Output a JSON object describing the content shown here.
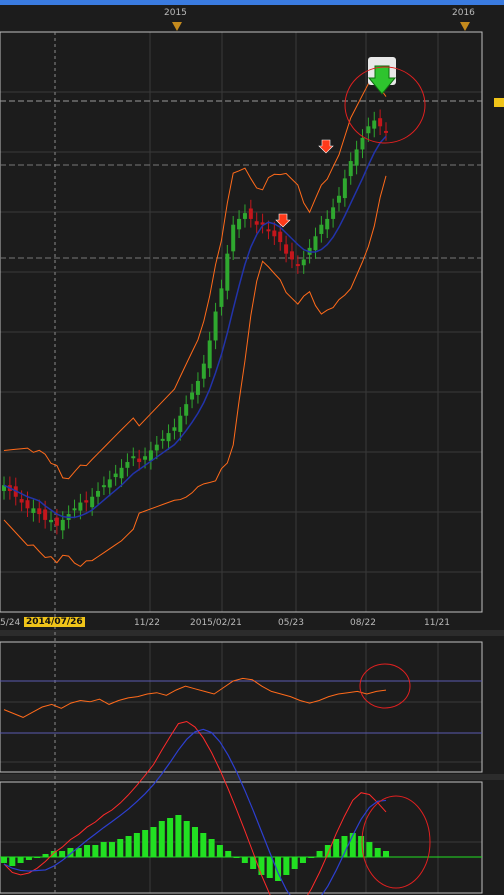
{
  "years": [
    "2015",
    "2016"
  ],
  "dates": [
    "5/24",
    "2014/07/26",
    "11/22",
    "2015/02/21",
    "05/23",
    "08/22",
    "11/21"
  ],
  "colors": {
    "background": "#1c1c1c",
    "grid": "#3a3a3a",
    "up_candle": "#2fa82f",
    "down_candle": "#c4161c",
    "bollinger": "#ff6a1a",
    "moving_avg": "#2233aa",
    "macd": "#ff2a2a",
    "signal": "#2d3fd0",
    "histogram": "#22e022",
    "marker_year": "#c48a1d",
    "annotation": "#e02020",
    "date_highlight": "#f0c419"
  },
  "chart_data": [
    {
      "type": "line",
      "panel": "price",
      "series": [
        {
          "name": "",
          "kind": "candles_close",
          "values": [
            100,
            99,
            98,
            97,
            96,
            96,
            95,
            94,
            94,
            93,
            94,
            95,
            96,
            97,
            97,
            98,
            99,
            100,
            101,
            102,
            103,
            104,
            105,
            104,
            105,
            106,
            107,
            108,
            109,
            110,
            112,
            114,
            116,
            118,
            121,
            125,
            130,
            134,
            140,
            145,
            146,
            147,
            146,
            145,
            145,
            144,
            143,
            142,
            140,
            139,
            138,
            139,
            141,
            143,
            145,
            146,
            148,
            150,
            153,
            156,
            158,
            160,
            162,
            163,
            162,
            161
          ]
        },
        {
          "name": "",
          "kind": "bollinger_upper"
        },
        {
          "name": "",
          "kind": "moving_average"
        },
        {
          "name": "",
          "kind": "bollinger_lower"
        }
      ],
      "signals": [
        "down-arrow",
        "down-arrow",
        "big-down-arrow"
      ],
      "grid": true
    },
    {
      "type": "line",
      "panel": "oscillator",
      "series": [
        {
          "name": "",
          "values": [
            48,
            45,
            42,
            46,
            50,
            52,
            49,
            53,
            55,
            54,
            56,
            52,
            55,
            57,
            58,
            60,
            61,
            59,
            63,
            66,
            64,
            62,
            60,
            65,
            70,
            72,
            71,
            66,
            62,
            60,
            58,
            55,
            53,
            55,
            58,
            60,
            61,
            62,
            60,
            62,
            63
          ]
        }
      ],
      "ylim": [
        0,
        100
      ],
      "levels": [
        70,
        30
      ]
    },
    {
      "type": "bar",
      "panel": "macd",
      "histogram": [
        -2,
        -3,
        -2,
        -1,
        0,
        1,
        2,
        2,
        3,
        3,
        4,
        4,
        5,
        5,
        6,
        7,
        8,
        9,
        10,
        12,
        13,
        14,
        12,
        10,
        8,
        6,
        4,
        2,
        0,
        -2,
        -4,
        -6,
        -7,
        -8,
        -6,
        -4,
        -2,
        0,
        2,
        4,
        6,
        7,
        8,
        7,
        5,
        3,
        2
      ],
      "series": [
        {
          "name": "",
          "kind": "macd"
        },
        {
          "name": "",
          "kind": "signal"
        }
      ]
    }
  ]
}
